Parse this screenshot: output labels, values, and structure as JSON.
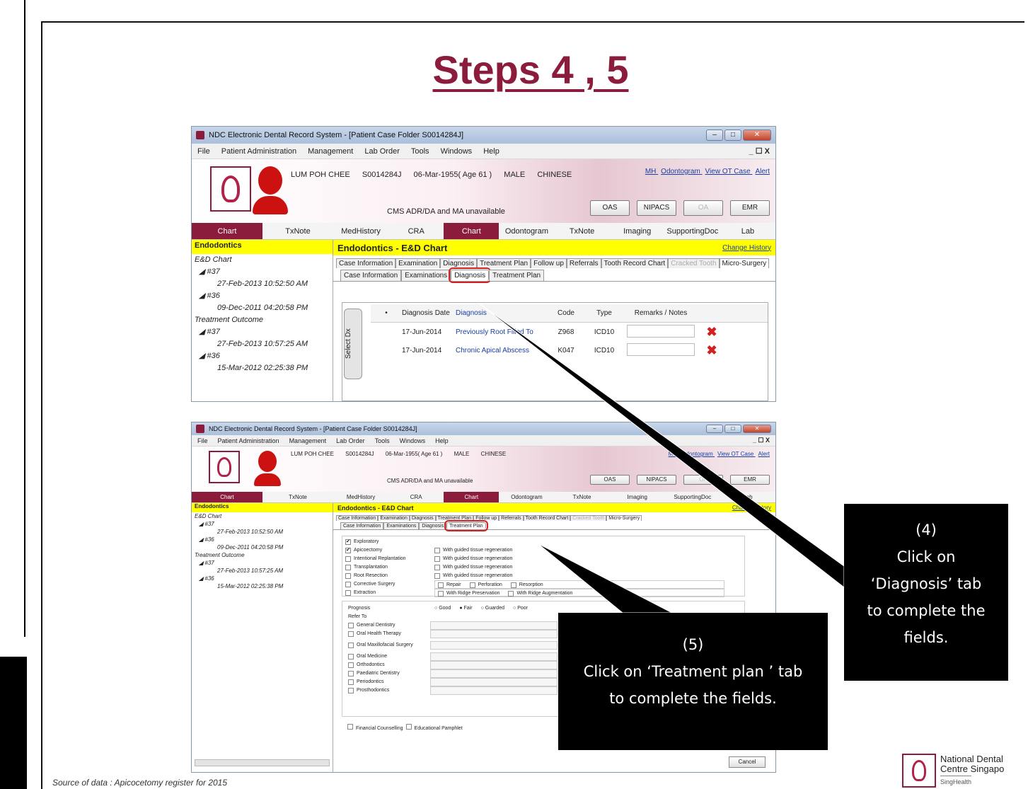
{
  "slide": {
    "title": "Steps 4 , 5",
    "source_note": "Source of data : Apicocetomy register for 2015",
    "logo_line1": "National Dental",
    "logo_line2": "Centre Singapo",
    "logo_line3": "SingHealth"
  },
  "window": {
    "title": "NDC Electronic Dental Record System - [Patient Case Folder S0014284J]",
    "controls": [
      "–",
      "□",
      "✕"
    ],
    "menu": [
      "File",
      "Patient Administration",
      "Management",
      "Lab Order",
      "Tools",
      "Windows",
      "Help"
    ],
    "mdi_controls": "_ ☐ X"
  },
  "patient": {
    "name": "LUM POH CHEE",
    "id": "S0014284J",
    "dob_age": "06-Mar-1955( Age 61 )",
    "gender": "MALE",
    "race": "CHINESE",
    "cms_status": "CMS ADR/DA and MA unavailable",
    "links": [
      "MH",
      "Odontogram",
      "View OT Case",
      "Alert"
    ],
    "buttons": [
      "OAS",
      "NIPACS",
      "OA",
      "EMR"
    ]
  },
  "nav": {
    "left_tabs": [
      "Chart",
      "TxNote"
    ],
    "right_tabs": [
      "MedHistory",
      "CRA",
      "Chart",
      "Odontogram",
      "TxNote",
      "Imaging",
      "SupportingDoc",
      "Lab"
    ]
  },
  "sidebar": {
    "heading": "Endodontics",
    "tree": [
      {
        "text": "E&D Chart",
        "level": 0
      },
      {
        "text": "◢ #37",
        "level": 1
      },
      {
        "text": "27-Feb-2013 10:52:50 AM",
        "level": 2
      },
      {
        "text": "◢ #36",
        "level": 1
      },
      {
        "text": "09-Dec-2011 04:20:58 PM",
        "level": 2
      },
      {
        "text": "Treatment Outcome",
        "level": 0
      },
      {
        "text": "◢ #37",
        "level": 1
      },
      {
        "text": "27-Feb-2013 10:57:25 AM",
        "level": 2
      },
      {
        "text": "◢ #36",
        "level": 1
      },
      {
        "text": "15-Mar-2012 02:25:38 PM",
        "level": 2
      }
    ]
  },
  "main": {
    "title": "Endodontics - E&D Chart",
    "change_history": "Change History",
    "tabs": [
      "Case Information",
      "Examination",
      "Diagnosis",
      "Treatment Plan",
      "Follow up",
      "Referrals",
      "Tooth Record Chart",
      "Cracked Tooth",
      "Micro-Surgery"
    ],
    "subtabs": [
      "Case Information",
      "Examinations",
      "Diagnosis",
      "Treatment Plan"
    ],
    "side_tab": "Select Dx",
    "grid_headers": [
      "•",
      "Diagnosis Date",
      "Diagnosis",
      "Code",
      "Type",
      "Remarks / Notes"
    ],
    "rows": [
      {
        "date": "17-Jun-2014",
        "diagnosis": "Previously Root Filled To",
        "code": "Z968",
        "type": "ICD10"
      },
      {
        "date": "17-Jun-2014",
        "diagnosis": "Chronic Apical Abscess",
        "code": "K047",
        "type": "ICD10"
      }
    ]
  },
  "treatment_plan": {
    "procedures": [
      {
        "label": "Exploratory",
        "checked": true
      },
      {
        "label": "Apicoectomy",
        "checked": true
      },
      {
        "label": "Intentional Replantation",
        "checked": false
      },
      {
        "label": "Transplantation",
        "checked": false
      },
      {
        "label": "Root Resection",
        "checked": false
      },
      {
        "label": "Corrective Surgery",
        "checked": false
      },
      {
        "label": "Extraction",
        "checked": false
      }
    ],
    "regeneration": [
      "With guided tissue regeneration",
      "With guided tissue regeneration",
      "With guided tissue regeneration",
      "With guided tissue regeneration"
    ],
    "corrective_options": [
      "Repair",
      "Perforation",
      "Resorption"
    ],
    "extraction_options": [
      "With Ridge Preservation",
      "With Ridge Augmentation"
    ],
    "prognosis_label": "Prognosis",
    "prognosis_options": [
      "Good",
      "Fair",
      "Guarded",
      "Poor"
    ],
    "refer_label": "Refer To",
    "refer_to": [
      "General Dentistry",
      "Oral Health Therapy",
      "Oral Maxillofacial Surgery",
      "Oral Medicine",
      "Orthodontics",
      "Paediatric Dentistry",
      "Periodontics",
      "Prosthodontics"
    ],
    "financial": "Financial Counselling",
    "pamphlet": "Educational Pamphlet",
    "cancel": "Cancel"
  },
  "callouts": {
    "step4": [
      "(4)",
      "Click on",
      "‘Diagnosis’ tab",
      "to complete the",
      "fields."
    ],
    "step5": [
      "(5)",
      "Click on ‘Treatment plan ’ tab",
      "to complete the fields."
    ]
  },
  "colors": {
    "title_maroon": "#8b1c3c",
    "highlight_yellow": "#ffff00",
    "callout_bg": "#000000",
    "red_box": "#d42020"
  }
}
